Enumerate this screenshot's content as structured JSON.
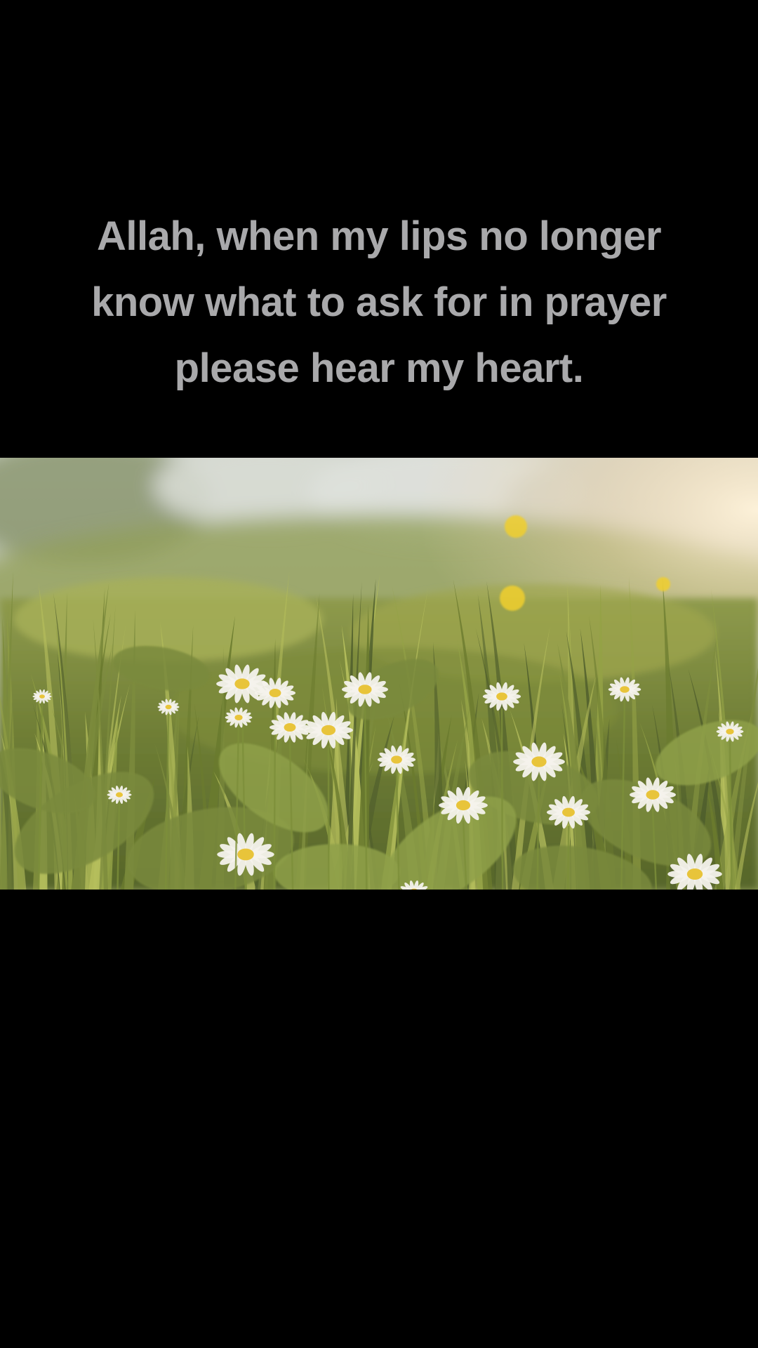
{
  "quote": {
    "lines": [
      "Allah, when my lips no longer",
      "know what to ask for in prayer",
      "please hear my heart."
    ]
  },
  "photo": {
    "subject": "meadow-with-daisies",
    "colors": {
      "sky": "#d9dcd6",
      "sun_glow": "#f3e2c2",
      "grass_dark": "#4f5e2c",
      "grass_mid": "#7d8c3d",
      "grass_light": "#b5be5c",
      "petal": "#f4f2ec",
      "center": "#e8c43a",
      "yellow_flower": "#f0cf2e"
    }
  },
  "background_color": "#000000"
}
